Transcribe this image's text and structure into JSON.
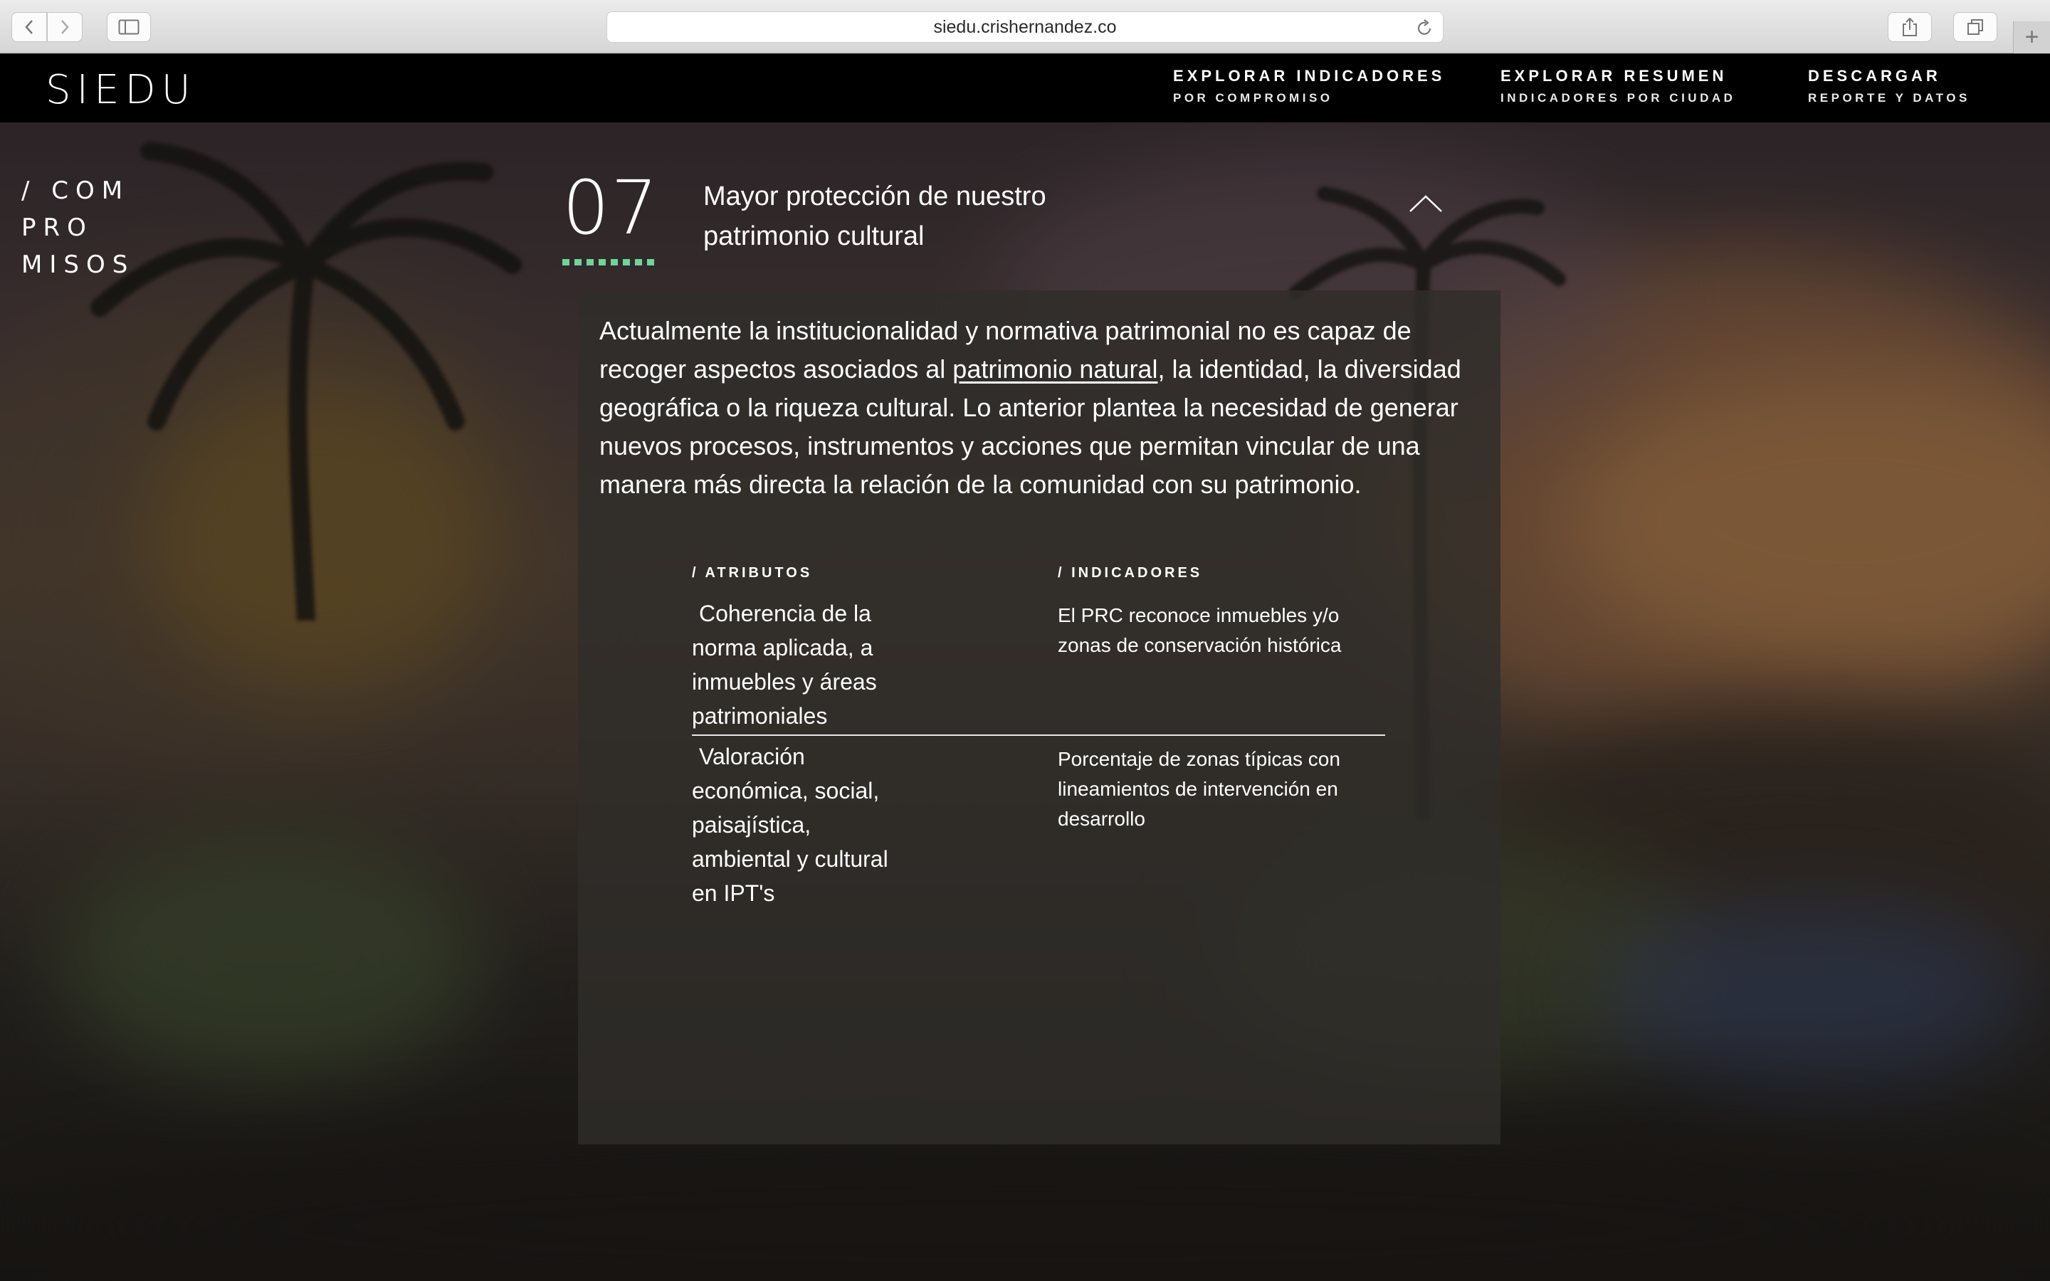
{
  "browser": {
    "url": "siedu.crishernandez.co"
  },
  "header": {
    "logo": "SIEDU",
    "nav": [
      {
        "main": "EXPLORAR INDICADORES",
        "sub": "POR COMPROMISO"
      },
      {
        "main": "EXPLORAR RESUMEN",
        "sub": "INDICADORES POR CIUDAD"
      },
      {
        "main": "DESCARGAR",
        "sub": "REPORTE Y DATOS"
      }
    ]
  },
  "sidebar": {
    "lines": [
      "/ COM",
      "PRO",
      "MISOS"
    ]
  },
  "commitment": {
    "number": "07",
    "title_line1": "Mayor protección de nuestro",
    "title_line2": "patrimonio cultural",
    "intro_before": "Actualmente la institucionalidad y normativa patrimonial no es capaz de recoger aspectos asociados al ",
    "intro_link": "patrimonio natural",
    "intro_after": ", la identidad, la diversidad geográfica o la riqueza cultural. Lo anterior plantea la necesidad de generar nuevos procesos, instrumentos y acciones que permitan vincular de una manera más directa la relación de la comunidad con su patrimonio.",
    "attributes_heading": "/ ATRIBUTOS",
    "indicators_heading": "/ INDICADORES",
    "rows": [
      {
        "attribute": "Coherencia de la norma aplicada, a inmuebles y áreas patrimoniales",
        "indicator": "El PRC reconoce inmuebles y/o zonas de conservación histórica"
      },
      {
        "attribute": "Valoración económica, social, paisajística, ambiental y cultural en IPT's",
        "indicator": "Porcentaje de zonas típicas con lineamientos de intervención en desarrollo"
      }
    ]
  },
  "colors": {
    "accent": "#6fd49a",
    "header_bg": "#000000",
    "panel_bg": "#302d2a"
  }
}
